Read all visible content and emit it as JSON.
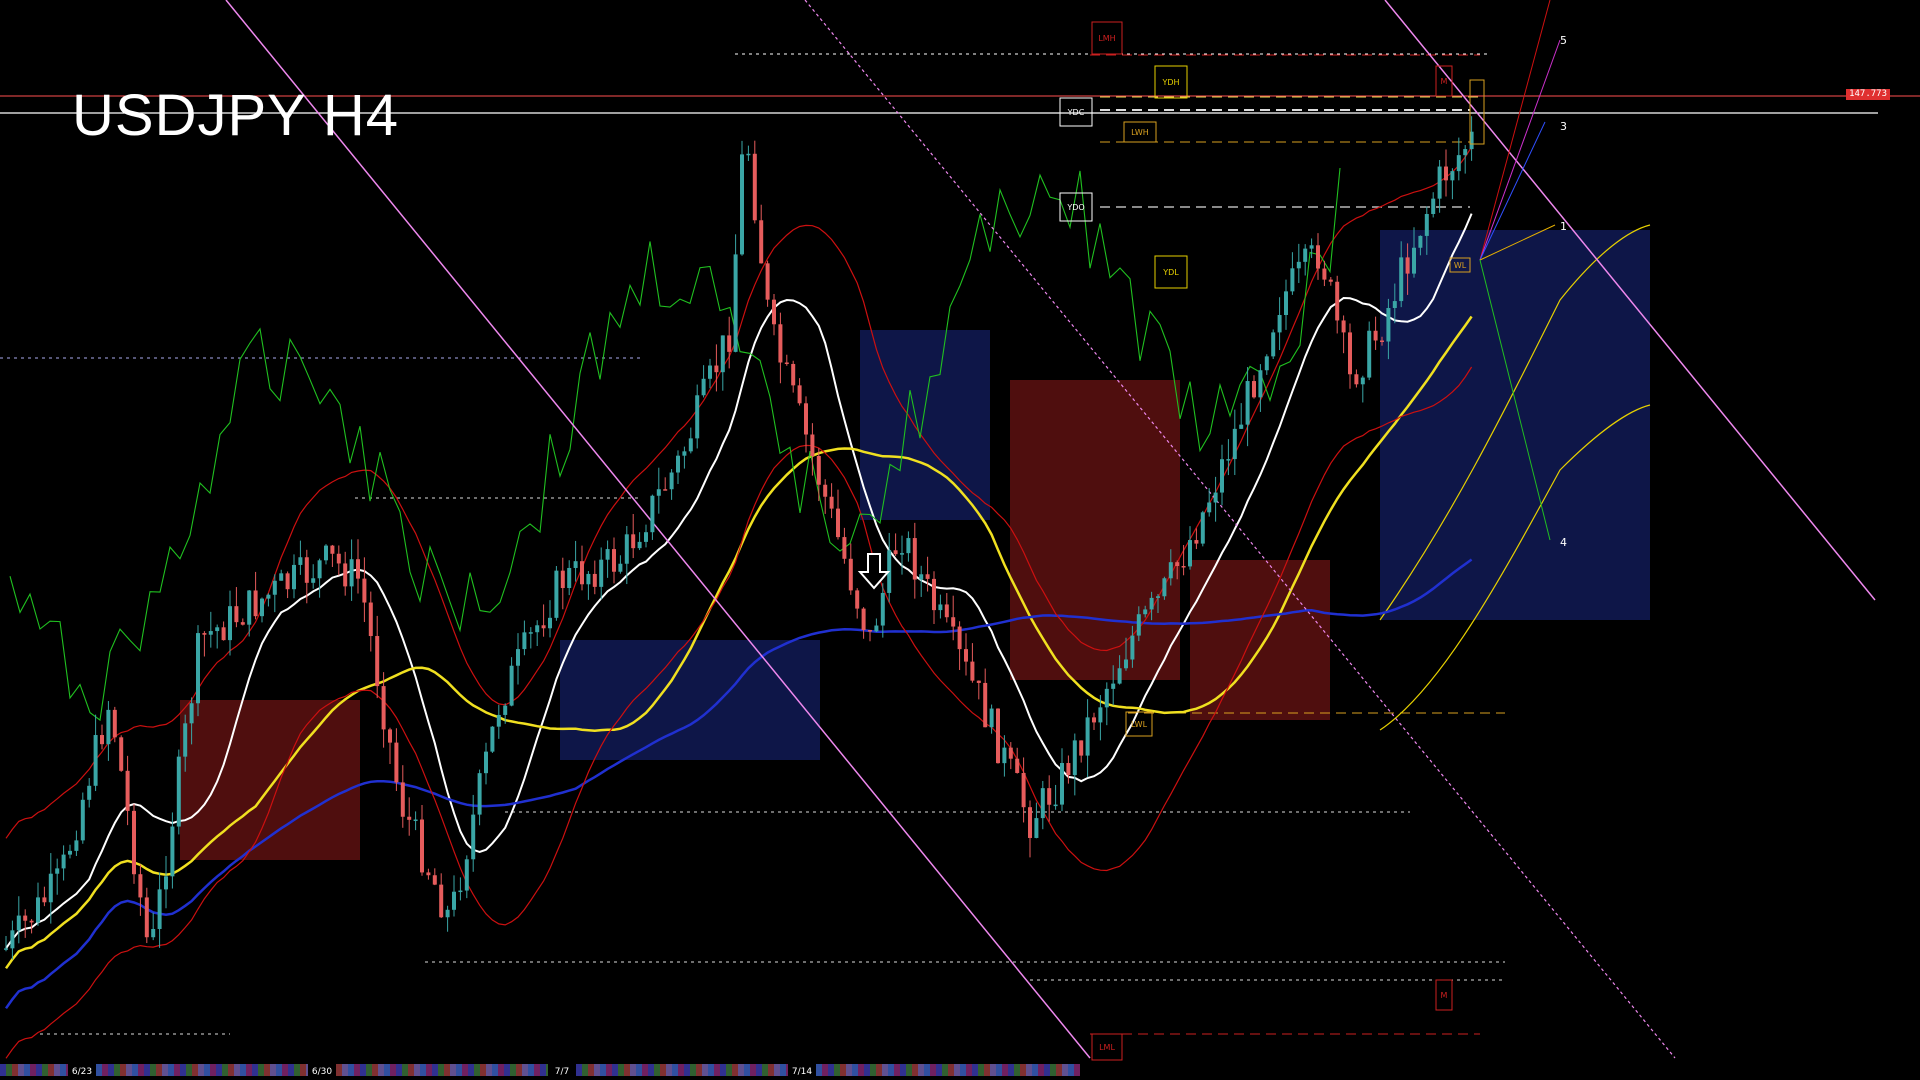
{
  "title": "USDJPY H4",
  "price_tag": "147.773",
  "level_labels": {
    "lmh": "LMH",
    "ydh": "YDH",
    "ydc": "YDC",
    "lwh": "LWH",
    "ydo": "YDO",
    "ydl": "YDL",
    "lwl": "LWL",
    "lml": "LML",
    "mh": "M",
    "ml": "M",
    "wl": "WL"
  },
  "projection_labels": [
    "5",
    "3",
    "1",
    "4"
  ],
  "date_labels": [
    "6/23",
    "6/30",
    "7/7",
    "7/14"
  ],
  "signal_icon": "down-arrow-icon",
  "colors": {
    "bull": "#3aa6a6",
    "bear": "#e65c5c",
    "ma_white": "#ffffff",
    "ma_yellow": "#f0e020",
    "ma_blue": "#2030d0",
    "green_line": "#20c020",
    "red_band": "#cc1010",
    "channel": "#ee88ee",
    "cloud_red": "#b02020",
    "cloud_blue": "#2030a0",
    "ref_line": "#ff6060"
  },
  "chart_data": {
    "type": "candlestick",
    "symbol": "USDJPY",
    "timeframe": "H4",
    "last_price": 147.773,
    "session_dates": [
      "6/23",
      "6/30",
      "7/7",
      "7/14"
    ],
    "overlays": [
      "moving averages",
      "ichimoku cloud",
      "bollinger bands",
      "descending channel",
      "daily/weekly/monthly levels"
    ]
  }
}
